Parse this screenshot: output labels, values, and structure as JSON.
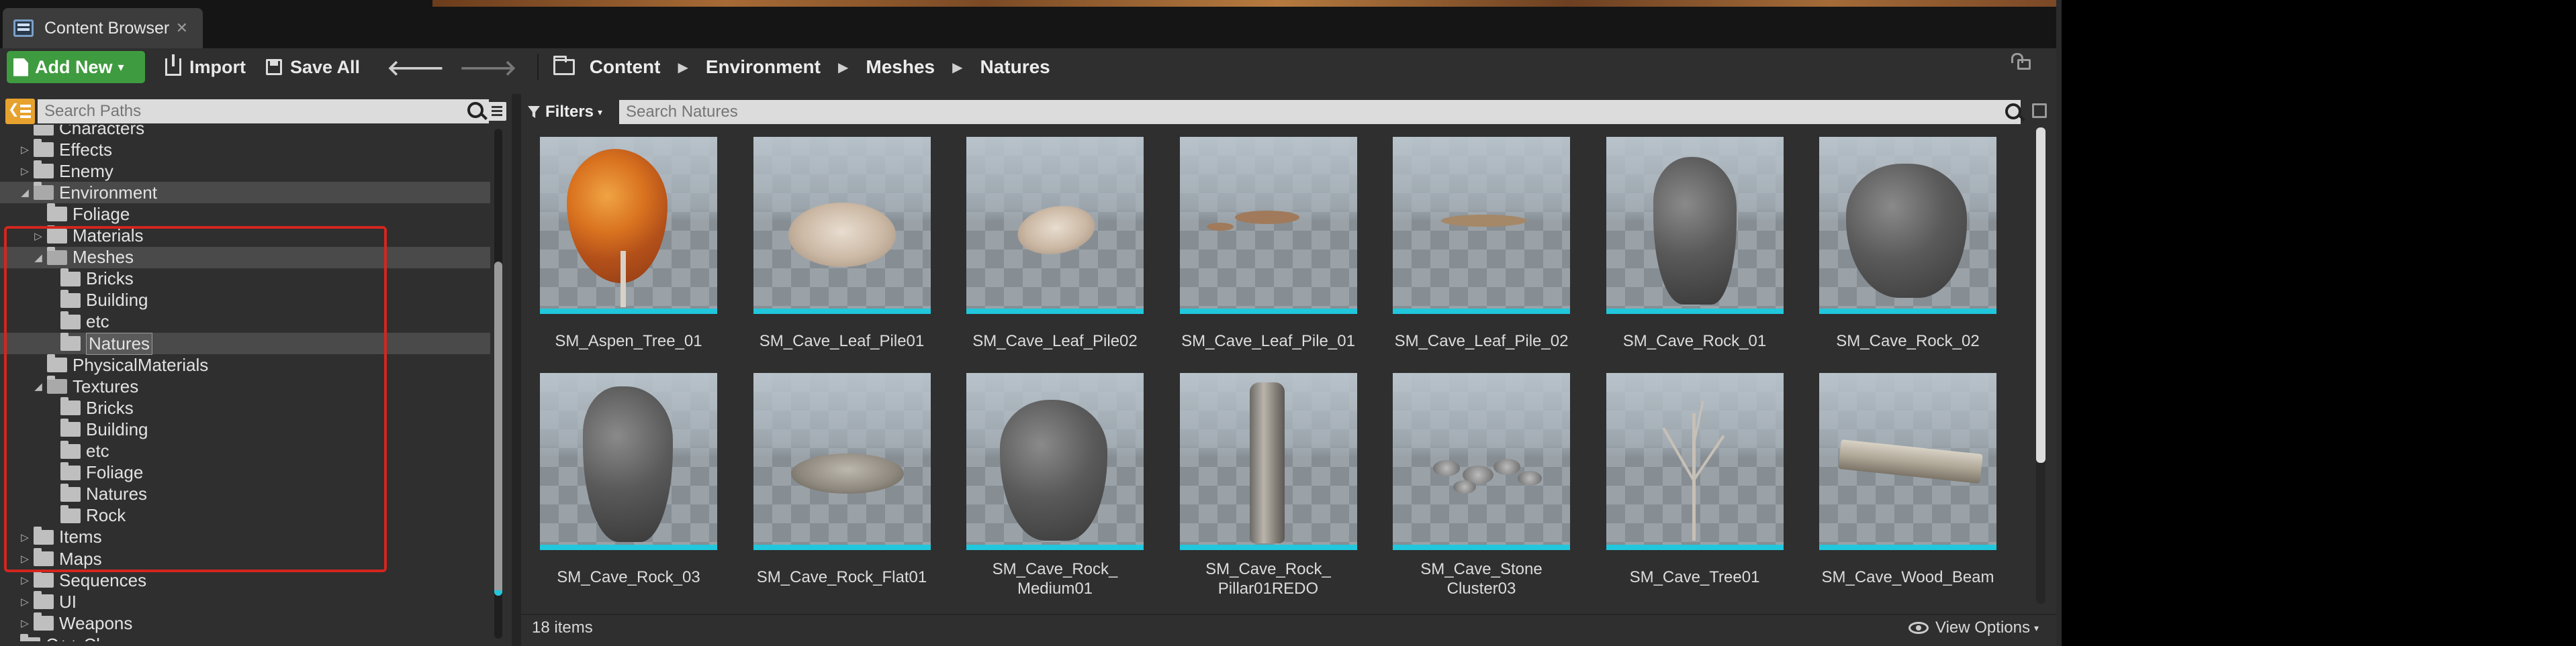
{
  "tab": {
    "title": "Content Browser",
    "close": "✕"
  },
  "toolbar": {
    "add_new": "Add New",
    "import": "Import",
    "save_all": "Save All",
    "back": "🡐",
    "forward": "🡒"
  },
  "breadcrumbs": [
    "Content",
    "Environment",
    "Meshes",
    "Natures"
  ],
  "breadcrumb_separator": "▶",
  "path_search": {
    "placeholder": "Search Paths"
  },
  "tree": [
    {
      "label": "Characters",
      "depth": 1,
      "arrow": "",
      "partial": true
    },
    {
      "label": "Effects",
      "depth": 1,
      "arrow": "▷"
    },
    {
      "label": "Enemy",
      "depth": 1,
      "arrow": "▷"
    },
    {
      "label": "Environment",
      "depth": 1,
      "arrow": "◢",
      "open": true,
      "selected": true
    },
    {
      "label": "Foliage",
      "depth": 2,
      "arrow": ""
    },
    {
      "label": "Materials",
      "depth": 2,
      "arrow": "▷"
    },
    {
      "label": "Meshes",
      "depth": 2,
      "arrow": "◢",
      "open": true,
      "selected": true
    },
    {
      "label": "Bricks",
      "depth": 3,
      "arrow": ""
    },
    {
      "label": "Building",
      "depth": 3,
      "arrow": ""
    },
    {
      "label": "etc",
      "depth": 3,
      "arrow": ""
    },
    {
      "label": "Natures",
      "depth": 3,
      "arrow": "",
      "selected": true,
      "boxed": true
    },
    {
      "label": "PhysicalMaterials",
      "depth": 2,
      "arrow": ""
    },
    {
      "label": "Textures",
      "depth": 2,
      "arrow": "◢",
      "open": true
    },
    {
      "label": "Bricks",
      "depth": 3,
      "arrow": ""
    },
    {
      "label": "Building",
      "depth": 3,
      "arrow": ""
    },
    {
      "label": "etc",
      "depth": 3,
      "arrow": ""
    },
    {
      "label": "Foliage",
      "depth": 3,
      "arrow": ""
    },
    {
      "label": "Natures",
      "depth": 3,
      "arrow": ""
    },
    {
      "label": "Rock",
      "depth": 3,
      "arrow": ""
    },
    {
      "label": "Items",
      "depth": 1,
      "arrow": "▷"
    },
    {
      "label": "Maps",
      "depth": 1,
      "arrow": "▷"
    },
    {
      "label": "Sequences",
      "depth": 1,
      "arrow": "▷"
    },
    {
      "label": "UI",
      "depth": 1,
      "arrow": "▷"
    },
    {
      "label": "Weapons",
      "depth": 1,
      "arrow": "▷"
    },
    {
      "label": "C++ Classes",
      "depth": 0,
      "arrow": "▷",
      "partial": true
    }
  ],
  "filters": {
    "label": "Filters",
    "caret": "▾"
  },
  "asset_search": {
    "placeholder": "Search Natures"
  },
  "assets": [
    {
      "name": "SM_Aspen_Tree_01",
      "art": "tree"
    },
    {
      "name": "SM_Cave_Leaf_Pile01",
      "art": "leafpile1"
    },
    {
      "name": "SM_Cave_Leaf_Pile02",
      "art": "leafpile2"
    },
    {
      "name": "SM_Cave_Leaf_Pile_01",
      "art": "leafscatter1"
    },
    {
      "name": "SM_Cave_Leaf_Pile_02",
      "art": "leafscatter2"
    },
    {
      "name": "SM_Cave_Rock_01",
      "art": "rocktall"
    },
    {
      "name": "SM_Cave_Rock_02",
      "art": "rockbig"
    },
    {
      "name": "SM_Cave_Rock_03",
      "art": "rocktall2"
    },
    {
      "name": "SM_Cave_Rock_Flat01",
      "art": "rockflat"
    },
    {
      "name": "SM_Cave_Rock_\nMedium01",
      "art": "rockmedium"
    },
    {
      "name": "SM_Cave_Rock_\nPillar01REDO",
      "art": "pillar"
    },
    {
      "name": "SM_Cave_Stone\nCluster03",
      "art": "pebbles"
    },
    {
      "name": "SM_Cave_Tree01",
      "art": "deadtree"
    },
    {
      "name": "SM_Cave_Wood_Beam",
      "art": "beam"
    }
  ],
  "status": {
    "item_count": "18 items",
    "view_options": "View Options",
    "caret": "▾"
  },
  "colors": {
    "accent_cyan": "#21c7dc",
    "add_new_green": "#3f9b3f",
    "annotation_red": "#d3261f",
    "toggle_orange": "#e7a12d"
  }
}
